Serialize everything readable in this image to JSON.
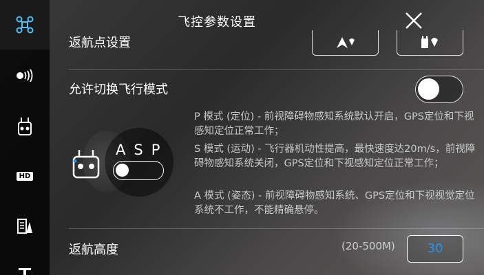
{
  "header": {
    "title": "飞控参数设置"
  },
  "sidebar": {
    "items": [
      {
        "icon": "aircraft-icon",
        "active": true
      },
      {
        "icon": "signal-icon"
      },
      {
        "icon": "remote-controller-icon"
      },
      {
        "icon": "hd-icon",
        "label": "HD"
      },
      {
        "icon": "checklist-icon"
      },
      {
        "icon": "more-icon"
      }
    ]
  },
  "return_home": {
    "label": "返航点设置"
  },
  "flight_mode": {
    "label": "允许切换飞行模式",
    "toggle_on": false,
    "asp_letters": "ASP",
    "descriptions": [
      "P 模式 (定位) - 前视障碍物感知系统默认开启，GPS定位和下视感知定位正常工作；",
      "S 模式 (运动) - 飞行器机动性提高，最快速度达20m/s，前视障碍物感知系统关闭，GPS定位和下视感知定位正常工作；",
      "A 模式 (姿态) - 前视障碍物感知系统、GPS定位和下视视觉定位系统不工作，不能精确悬停。"
    ]
  },
  "return_height": {
    "label": "返航高度",
    "range": "(20-500M)",
    "value": "30"
  },
  "colors": {
    "accent": "#2196f3",
    "sidebar_active": "#4fc3f7"
  }
}
